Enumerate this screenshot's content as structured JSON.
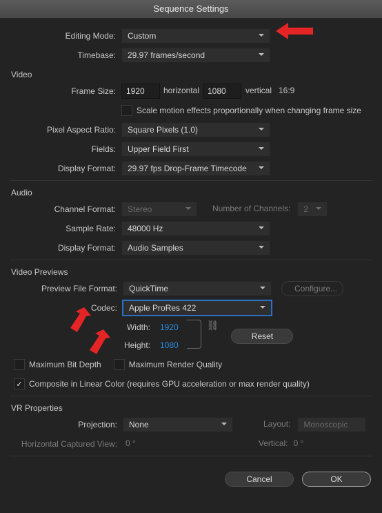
{
  "title": "Sequence Settings",
  "editing_mode_label": "Editing Mode:",
  "editing_mode_value": "Custom",
  "timebase_label": "Timebase:",
  "timebase_value": "29.97  frames/second",
  "video": {
    "heading": "Video",
    "frame_size_label": "Frame Size:",
    "frame_w": "1920",
    "horizontal": "horizontal",
    "frame_h": "1080",
    "vertical": "vertical",
    "aspect": "16:9",
    "scale_effects": "Scale motion effects proportionally when changing frame size",
    "par_label": "Pixel Aspect Ratio:",
    "par_value": "Square Pixels (1.0)",
    "fields_label": "Fields:",
    "fields_value": "Upper Field First",
    "display_format_label": "Display Format:",
    "display_format_value": "29.97 fps Drop-Frame Timecode"
  },
  "audio": {
    "heading": "Audio",
    "channel_format_label": "Channel Format:",
    "channel_format_value": "Stereo",
    "num_channels_label": "Number of Channels:",
    "num_channels_value": "2",
    "sample_rate_label": "Sample Rate:",
    "sample_rate_value": "48000 Hz",
    "display_format_label": "Display Format:",
    "display_format_value": "Audio Samples"
  },
  "previews": {
    "heading": "Video Previews",
    "file_format_label": "Preview File Format:",
    "file_format_value": "QuickTime",
    "configure": "Configure...",
    "codec_label": "Codec:",
    "codec_value": "Apple ProRes 422",
    "width_label": "Width:",
    "width_value": "1920",
    "height_label": "Height:",
    "height_value": "1080",
    "reset": "Reset",
    "max_bit_depth": "Maximum Bit Depth",
    "max_render_quality": "Maximum Render Quality",
    "composite_linear": "Composite in Linear Color (requires GPU acceleration or max render quality)"
  },
  "vr": {
    "heading": "VR Properties",
    "projection_label": "Projection:",
    "projection_value": "None",
    "layout_label": "Layout:",
    "layout_value": "Monoscopic",
    "hcv_label": "Horizontal Captured View:",
    "hcv_value": "0 °",
    "vert_label": "Vertical:",
    "vert_value": "0 °"
  },
  "buttons": {
    "cancel": "Cancel",
    "ok": "OK"
  }
}
